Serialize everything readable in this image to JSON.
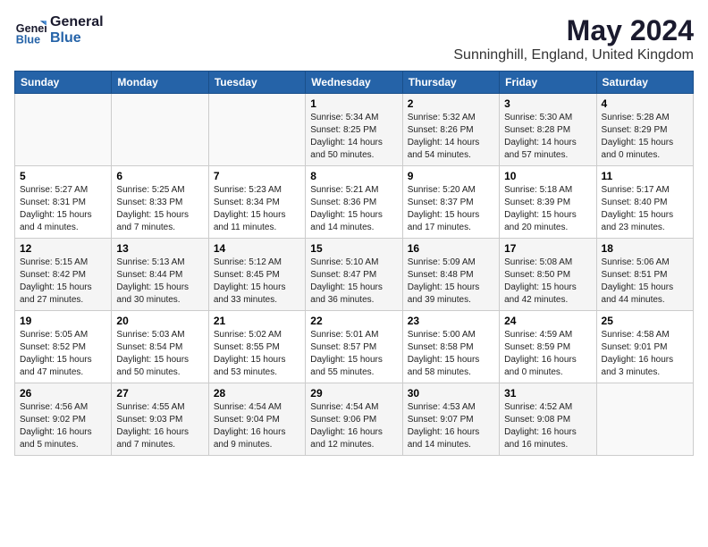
{
  "logo": {
    "line1": "General",
    "line2": "Blue"
  },
  "title": "May 2024",
  "subtitle": "Sunninghill, England, United Kingdom",
  "days_header": [
    "Sunday",
    "Monday",
    "Tuesday",
    "Wednesday",
    "Thursday",
    "Friday",
    "Saturday"
  ],
  "weeks": [
    [
      {
        "day": "",
        "info": ""
      },
      {
        "day": "",
        "info": ""
      },
      {
        "day": "",
        "info": ""
      },
      {
        "day": "1",
        "info": "Sunrise: 5:34 AM\nSunset: 8:25 PM\nDaylight: 14 hours\nand 50 minutes."
      },
      {
        "day": "2",
        "info": "Sunrise: 5:32 AM\nSunset: 8:26 PM\nDaylight: 14 hours\nand 54 minutes."
      },
      {
        "day": "3",
        "info": "Sunrise: 5:30 AM\nSunset: 8:28 PM\nDaylight: 14 hours\nand 57 minutes."
      },
      {
        "day": "4",
        "info": "Sunrise: 5:28 AM\nSunset: 8:29 PM\nDaylight: 15 hours\nand 0 minutes."
      }
    ],
    [
      {
        "day": "5",
        "info": "Sunrise: 5:27 AM\nSunset: 8:31 PM\nDaylight: 15 hours\nand 4 minutes."
      },
      {
        "day": "6",
        "info": "Sunrise: 5:25 AM\nSunset: 8:33 PM\nDaylight: 15 hours\nand 7 minutes."
      },
      {
        "day": "7",
        "info": "Sunrise: 5:23 AM\nSunset: 8:34 PM\nDaylight: 15 hours\nand 11 minutes."
      },
      {
        "day": "8",
        "info": "Sunrise: 5:21 AM\nSunset: 8:36 PM\nDaylight: 15 hours\nand 14 minutes."
      },
      {
        "day": "9",
        "info": "Sunrise: 5:20 AM\nSunset: 8:37 PM\nDaylight: 15 hours\nand 17 minutes."
      },
      {
        "day": "10",
        "info": "Sunrise: 5:18 AM\nSunset: 8:39 PM\nDaylight: 15 hours\nand 20 minutes."
      },
      {
        "day": "11",
        "info": "Sunrise: 5:17 AM\nSunset: 8:40 PM\nDaylight: 15 hours\nand 23 minutes."
      }
    ],
    [
      {
        "day": "12",
        "info": "Sunrise: 5:15 AM\nSunset: 8:42 PM\nDaylight: 15 hours\nand 27 minutes."
      },
      {
        "day": "13",
        "info": "Sunrise: 5:13 AM\nSunset: 8:44 PM\nDaylight: 15 hours\nand 30 minutes."
      },
      {
        "day": "14",
        "info": "Sunrise: 5:12 AM\nSunset: 8:45 PM\nDaylight: 15 hours\nand 33 minutes."
      },
      {
        "day": "15",
        "info": "Sunrise: 5:10 AM\nSunset: 8:47 PM\nDaylight: 15 hours\nand 36 minutes."
      },
      {
        "day": "16",
        "info": "Sunrise: 5:09 AM\nSunset: 8:48 PM\nDaylight: 15 hours\nand 39 minutes."
      },
      {
        "day": "17",
        "info": "Sunrise: 5:08 AM\nSunset: 8:50 PM\nDaylight: 15 hours\nand 42 minutes."
      },
      {
        "day": "18",
        "info": "Sunrise: 5:06 AM\nSunset: 8:51 PM\nDaylight: 15 hours\nand 44 minutes."
      }
    ],
    [
      {
        "day": "19",
        "info": "Sunrise: 5:05 AM\nSunset: 8:52 PM\nDaylight: 15 hours\nand 47 minutes."
      },
      {
        "day": "20",
        "info": "Sunrise: 5:03 AM\nSunset: 8:54 PM\nDaylight: 15 hours\nand 50 minutes."
      },
      {
        "day": "21",
        "info": "Sunrise: 5:02 AM\nSunset: 8:55 PM\nDaylight: 15 hours\nand 53 minutes."
      },
      {
        "day": "22",
        "info": "Sunrise: 5:01 AM\nSunset: 8:57 PM\nDaylight: 15 hours\nand 55 minutes."
      },
      {
        "day": "23",
        "info": "Sunrise: 5:00 AM\nSunset: 8:58 PM\nDaylight: 15 hours\nand 58 minutes."
      },
      {
        "day": "24",
        "info": "Sunrise: 4:59 AM\nSunset: 8:59 PM\nDaylight: 16 hours\nand 0 minutes."
      },
      {
        "day": "25",
        "info": "Sunrise: 4:58 AM\nSunset: 9:01 PM\nDaylight: 16 hours\nand 3 minutes."
      }
    ],
    [
      {
        "day": "26",
        "info": "Sunrise: 4:56 AM\nSunset: 9:02 PM\nDaylight: 16 hours\nand 5 minutes."
      },
      {
        "day": "27",
        "info": "Sunrise: 4:55 AM\nSunset: 9:03 PM\nDaylight: 16 hours\nand 7 minutes."
      },
      {
        "day": "28",
        "info": "Sunrise: 4:54 AM\nSunset: 9:04 PM\nDaylight: 16 hours\nand 9 minutes."
      },
      {
        "day": "29",
        "info": "Sunrise: 4:54 AM\nSunset: 9:06 PM\nDaylight: 16 hours\nand 12 minutes."
      },
      {
        "day": "30",
        "info": "Sunrise: 4:53 AM\nSunset: 9:07 PM\nDaylight: 16 hours\nand 14 minutes."
      },
      {
        "day": "31",
        "info": "Sunrise: 4:52 AM\nSunset: 9:08 PM\nDaylight: 16 hours\nand 16 minutes."
      },
      {
        "day": "",
        "info": ""
      }
    ]
  ]
}
